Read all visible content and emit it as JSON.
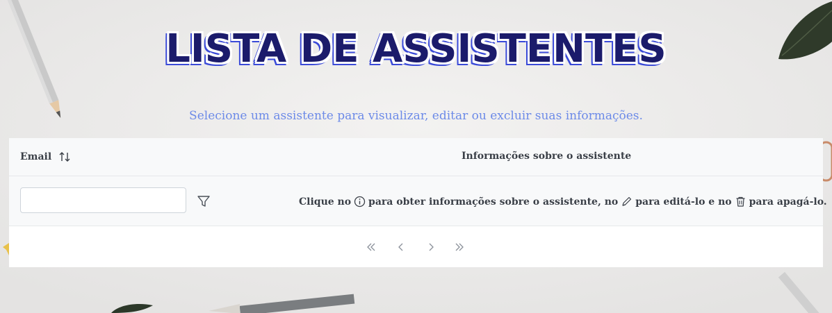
{
  "page": {
    "title": "LISTA DE ASSISTENTES",
    "subtitle": "Selecione um assistente para visualizar, editar ou excluir suas informações."
  },
  "table": {
    "columns": {
      "email": "Email",
      "info": "Informações sobre o assistente"
    },
    "filter": {
      "value": "",
      "placeholder": ""
    },
    "help": {
      "part1": "Clique no",
      "part2": "para obter informações sobre o assistente, no",
      "part3": "para editá-lo e no",
      "part4": "para apagá-lo."
    },
    "icons": {
      "sort": "sort-icon",
      "filter": "filter-icon",
      "info": "info-icon",
      "edit": "pencil-icon",
      "delete": "trash-icon"
    }
  },
  "paginator": {
    "icons": [
      "first-page-icon",
      "prev-page-icon",
      "next-page-icon",
      "last-page-icon"
    ]
  },
  "colors": {
    "title": "#1b1b6b",
    "title_outline": "#3a4ad8",
    "subtitle": "#6c8ae8",
    "header_bg": "#f8f9fa",
    "text": "#3a3f47"
  }
}
